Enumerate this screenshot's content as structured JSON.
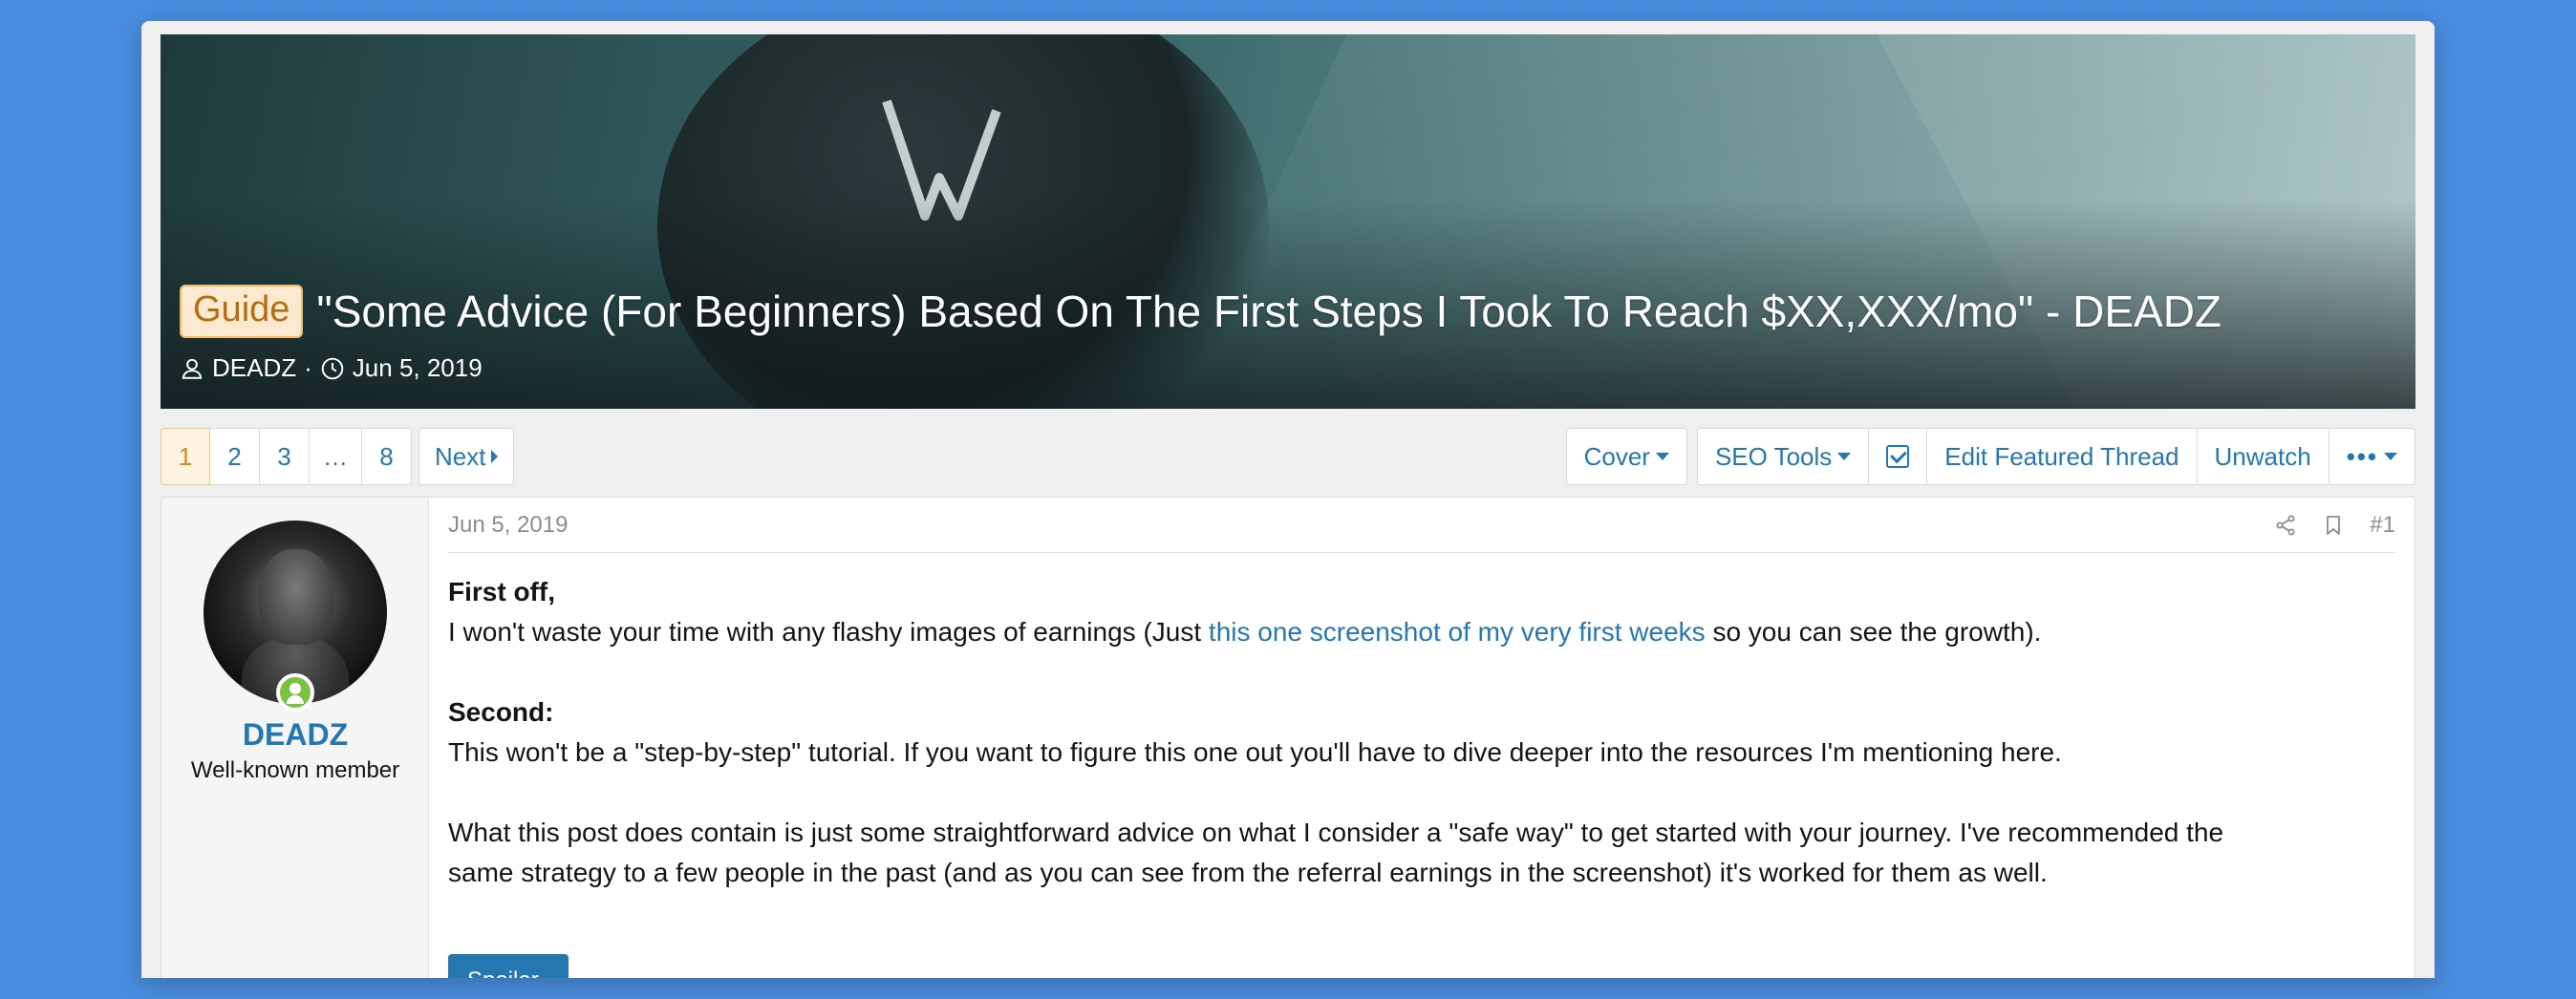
{
  "thread": {
    "prefix": "Guide",
    "title": "\"Some Advice (For Beginners) Based On The First Steps I Took To Reach $XX,XXX/mo\" - DEADZ",
    "author": "DEADZ",
    "separator": "·",
    "date": "Jun 5, 2019"
  },
  "pagination": {
    "pages": [
      "1",
      "2",
      "3",
      "…",
      "8"
    ],
    "active": "1",
    "next_label": "Next"
  },
  "toolbar": {
    "cover_label": "Cover",
    "seo_tools_label": "SEO Tools",
    "edit_featured_label": "Edit Featured Thread",
    "unwatch_label": "Unwatch",
    "more_label": "•••"
  },
  "post": {
    "username": "DEADZ",
    "user_title": "Well-known member",
    "date": "Jun 5, 2019",
    "number": "#1",
    "p1_heading": "First off,",
    "p1_before": "I won't waste your time with any flashy images of earnings (Just ",
    "p1_link": "this one screenshot of my very first weeks",
    "p1_after": " so you can see the growth).",
    "p2_heading": "Second:",
    "p2_text": "This won't be a \"step-by-step\" tutorial. If you want to figure this one out you'll have to dive deeper into the resources I'm mentioning here.",
    "p3_line1": "What this post does contain is just some straightforward advice on what I consider a \"safe way\" to get started with your journey. I've recommended the",
    "p3_line2": "same strategy to a few people in the past (and as you can see from the referral earnings in the screenshot) it's worked for them as well.",
    "spoiler_label": "Spoiler"
  },
  "colors": {
    "link": "#2577b1",
    "prefix_bg": "#fde9cf",
    "prefix_text": "#b56d13",
    "online": "#7bc142",
    "page_bg": "#4a8ee0"
  },
  "icons": [
    "user-icon",
    "clock-icon",
    "share-icon",
    "bookmark-icon",
    "checkbox-icon",
    "caret-down-icon",
    "caret-right-icon"
  ]
}
